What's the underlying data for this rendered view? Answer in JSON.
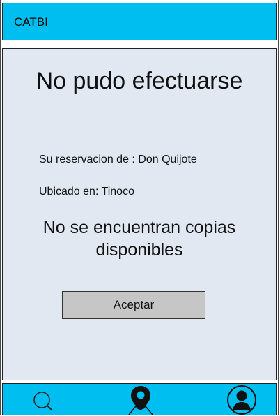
{
  "app_bar": {
    "title": "CATBI",
    "color": "#00bff0"
  },
  "dialog": {
    "headline": "No pudo efectuarse",
    "reservation_text": "Su reservacion de : Don Quijote",
    "location_text": "Ubicado en: Tinoco",
    "message": "No se encuentran copias disponibles",
    "accept_label": "Aceptar",
    "background_color": "#e1e8f1"
  },
  "bottom_nav": {
    "color": "#00bff0",
    "items": [
      {
        "icon": "search-icon"
      },
      {
        "icon": "map-pin-icon"
      },
      {
        "icon": "profile-icon"
      }
    ]
  }
}
